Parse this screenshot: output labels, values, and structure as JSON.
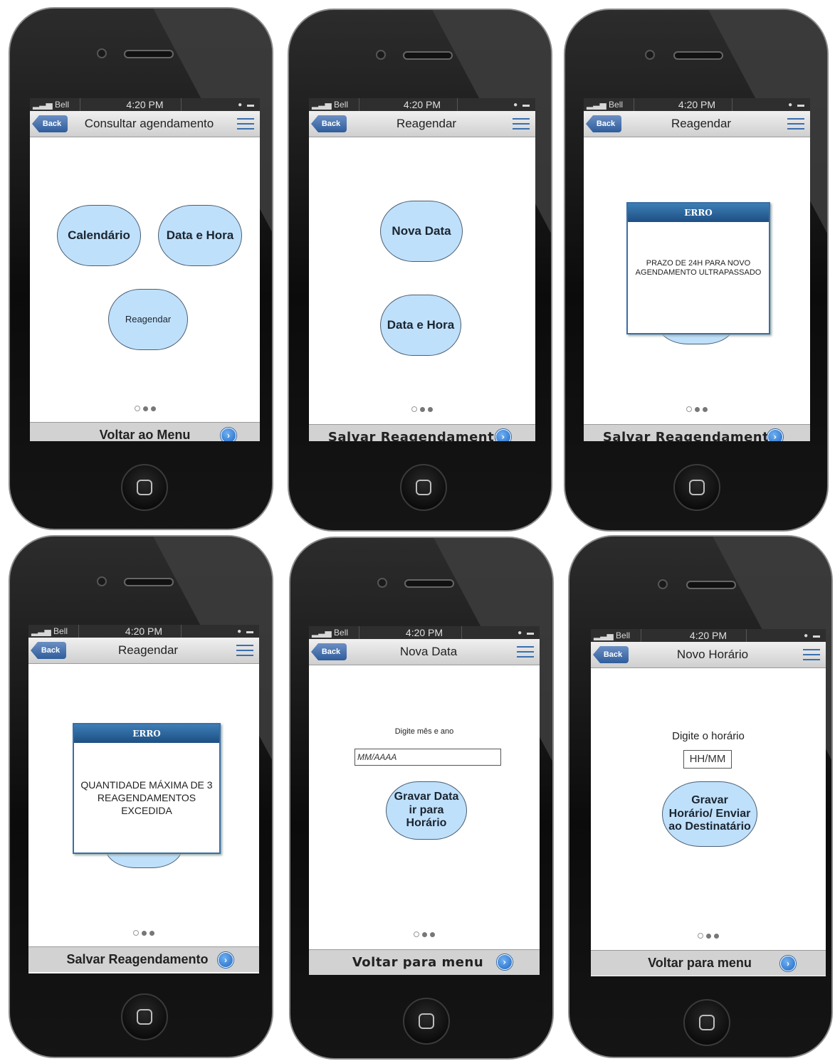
{
  "status": {
    "carrier": "Bell",
    "time": "4:20 PM"
  },
  "phones": [
    {
      "title": "Consultar agendamento",
      "back": "Back",
      "buttons": [
        "Calendário",
        "Data e Hora",
        "Reagendar"
      ],
      "footer": "Voltar ao Menu"
    },
    {
      "title": "Reagendar",
      "back": "Back",
      "buttons": [
        "Nova Data",
        "Data e Hora"
      ],
      "footer": "Salvar Reagendamento"
    },
    {
      "title": "Reagendar",
      "back": "Back",
      "dialog": {
        "header": "ERRO",
        "message": "PRAZO DE 24H PARA NOVO AGENDAMENTO ULTRAPASSADO"
      },
      "footer": "Salvar Reagendamento"
    },
    {
      "title": "Reagendar",
      "back": "Back",
      "dialog": {
        "header": "ERRO",
        "message": "QUANTIDADE MÁXIMA DE 3 REAGENDAMENTOS EXCEDIDA"
      },
      "footer": "Salvar Reagendamento"
    },
    {
      "title": "Nova Data",
      "back": "Back",
      "label": "Digite mês e ano",
      "input_value": "MM/AAAA",
      "button": "Gravar Data ir para Horário",
      "footer": "Voltar para menu"
    },
    {
      "title": "Novo Horário",
      "back": "Back",
      "label": "Digite o horário",
      "input_value": "HH/MM",
      "button": "Gravar Horário/ Enviar ao Destinatário",
      "footer": "Voltar para menu"
    }
  ]
}
